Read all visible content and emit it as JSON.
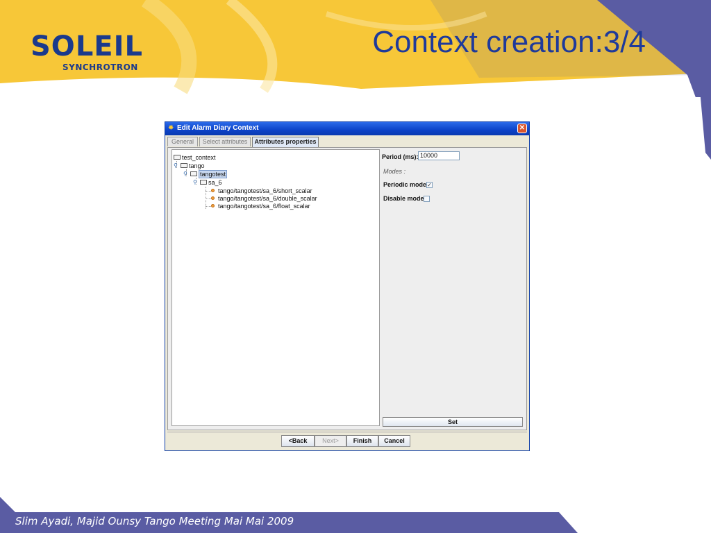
{
  "slide": {
    "title": "Context creation:3/4",
    "logo_main": "SOLEIL",
    "logo_sub": "SYNCHROTRON",
    "footer": "Slim Ayadi, Majid Ounsy Tango Meeting Mai Mai 2009",
    "colors": {
      "header_yellow": "#f7c738",
      "accent_blue": "#5a5ca3",
      "title_blue": "#1f3a9a"
    }
  },
  "window": {
    "title": "Edit Alarm Diary Context",
    "icon": "app-icon",
    "close_icon": "close-icon",
    "close_glyph": "✕"
  },
  "tabs": [
    {
      "label": "General",
      "active": false
    },
    {
      "label": "Select attributes",
      "active": false
    },
    {
      "label": "Attributes properties",
      "active": true
    }
  ],
  "tree": {
    "root": "test_context",
    "nodes": {
      "tango": "tango",
      "tangotest": "tangotest",
      "sa_6": "sa_6"
    },
    "leaves": [
      "tango/tangotest/sa_6/short_scalar",
      "tango/tangotest/sa_6/double_scalar",
      "tango/tangotest/sa_6/float_scalar"
    ],
    "handle_glyph": "⚲",
    "selected": "tangotest"
  },
  "properties": {
    "period_label": "Period (ms):*",
    "period_value": "10000",
    "modes_label": "Modes :",
    "periodic_mode_label": "Periodic mode",
    "periodic_mode_checked": true,
    "disable_mode_label": "Disable mode",
    "disable_mode_checked": false,
    "check_glyph": "✓",
    "set_label": "Set"
  },
  "buttons": {
    "back": "<Back",
    "next": "Next>",
    "finish": "Finish",
    "cancel": "Cancel"
  }
}
